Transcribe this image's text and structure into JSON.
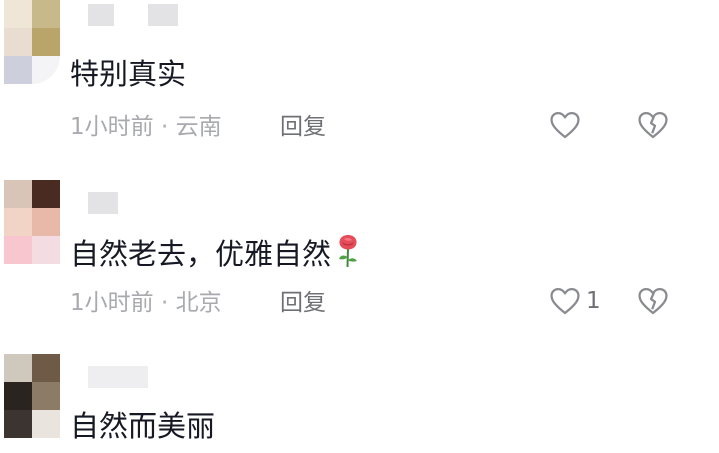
{
  "comments": [
    {
      "text": "特别真实",
      "meta": "1小时前 · 云南",
      "reply_label": "回复",
      "like_count": ""
    },
    {
      "text": "自然老去，优雅自然",
      "emoji": "rose",
      "meta": "1小时前 · 北京",
      "reply_label": "回复",
      "like_count": "1"
    },
    {
      "text": "自然而美丽"
    }
  ],
  "colors": {
    "text": "#161823",
    "meta": "#a9aaae",
    "reply": "#6f7075",
    "icon": "#8a8b90",
    "masked_name": "#e3e3e6"
  },
  "icons": {
    "like": "heart-outline-icon",
    "dislike": "broken-heart-icon",
    "emoji": "rose-emoji-icon"
  }
}
